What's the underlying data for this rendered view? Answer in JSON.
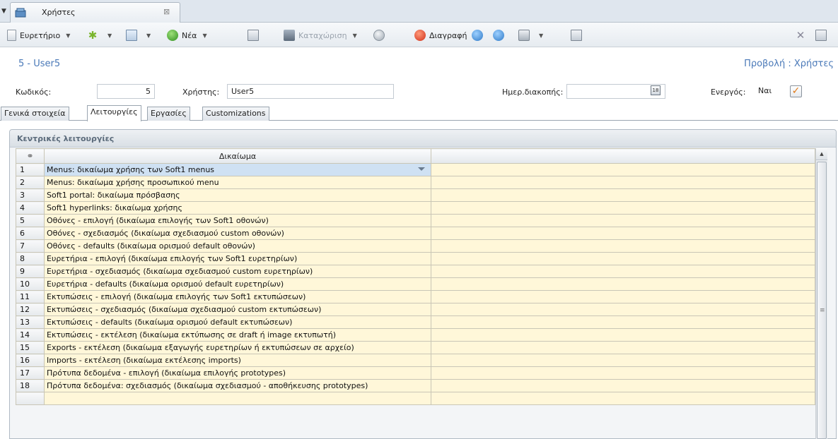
{
  "tab": {
    "title": "Χρήστες",
    "close_symbol": "⊠"
  },
  "toolbar": {
    "index_label": "Ευρετήριο",
    "new_label": "Νέα",
    "save_label": "Καταχώριση",
    "delete_label": "Διαγραφή"
  },
  "record": {
    "title": "5 - User5",
    "view_title": "Προβολή : Χρήστες"
  },
  "fields": {
    "code_label": "Κωδικός:",
    "code_value": "5",
    "user_label": "Χρήστης:",
    "user_value": "User5",
    "suspend_label": "Ημερ.διακοπής:",
    "suspend_value": "",
    "active_label": "Ενεργός:",
    "active_value": "Ναι",
    "active_checked": true
  },
  "subtabs": [
    "Γενικά στοιχεία",
    "Λειτουργίες",
    "Εργασίες",
    "Customizations"
  ],
  "active_subtab": 1,
  "section": {
    "title": "Κεντρικές λειτουργίες"
  },
  "grid": {
    "header": "Δικαίωμα",
    "selected_row": 0,
    "rows": [
      {
        "num": "1",
        "perm": "Menus: δικαίωμα χρήσης των Soft1 menus"
      },
      {
        "num": "2",
        "perm": "Menus: δικαίωμα χρήσης προσωπικού menu"
      },
      {
        "num": "3",
        "perm": "Soft1 portal: δικαίωμα πρόσβασης"
      },
      {
        "num": "4",
        "perm": "Soft1 hyperlinks: δικαίωμα χρήσης"
      },
      {
        "num": "5",
        "perm": "Οθόνες - επιλογή (δικαίωμα επιλογής των Soft1 οθονών)"
      },
      {
        "num": "6",
        "perm": "Οθόνες - σχεδιασμός (δικαίωμα σχεδιασμού custom οθονών)"
      },
      {
        "num": "7",
        "perm": "Οθόνες - defaults (δικαίωμα ορισμού default οθονών)"
      },
      {
        "num": "8",
        "perm": "Ευρετήρια - επιλογή (δικαίωμα επιλογής των Soft1 ευρετηρίων)"
      },
      {
        "num": "9",
        "perm": "Ευρετήρια - σχεδιασμός (δικαίωμα σχεδιασμού custom ευρετηρίων)"
      },
      {
        "num": "10",
        "perm": "Ευρετήρια - defaults (δικαίωμα ορισμού default ευρετηρίων)"
      },
      {
        "num": "11",
        "perm": "Εκτυπώσεις - επιλογή (δικαίωμα επιλογής των Soft1 εκτυπώσεων)"
      },
      {
        "num": "12",
        "perm": "Εκτυπώσεις - σχεδιασμός (δικαίωμα σχεδιασμού custom εκτυπώσεων)"
      },
      {
        "num": "13",
        "perm": "Εκτυπώσεις - defaults (δικαίωμα ορισμού default εκτυπώσεων)"
      },
      {
        "num": "14",
        "perm": "Εκτυπώσεις - εκτέλεση (δικαίωμα εκτύπωσης σε draft ή image εκτυπωτή)"
      },
      {
        "num": "15",
        "perm": "Exports - εκτέλεση (δικαίωμα εξαγωγής ευρετηρίων ή εκτυπώσεων σε αρχείο)"
      },
      {
        "num": "16",
        "perm": "Imports - εκτέλεση (δικαίωμα εκτέλεσης imports)"
      },
      {
        "num": "17",
        "perm": "Πρότυπα δεδομένα - επιλογή (δικαίωμα επιλογής prototypes)"
      },
      {
        "num": "18",
        "perm": "Πρότυπα δεδομένα: σχεδιασμός (δικαίωμα σχεδιασμού - αποθήκευσης prototypes)"
      }
    ]
  }
}
